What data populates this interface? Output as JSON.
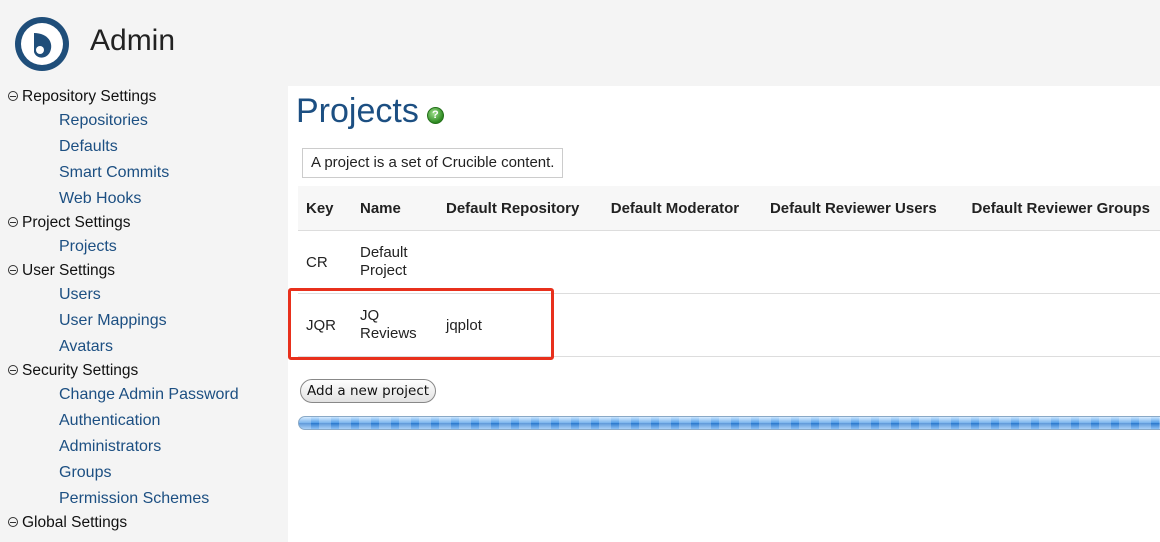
{
  "header": {
    "title": "Admin",
    "logo_icon": "crucible-logo-icon"
  },
  "sidebar": {
    "sections": [
      {
        "label": "Repository Settings",
        "items": [
          "Repositories",
          "Defaults",
          "Smart Commits",
          "Web Hooks"
        ]
      },
      {
        "label": "Project Settings",
        "items": [
          "Projects"
        ]
      },
      {
        "label": "User Settings",
        "items": [
          "Users",
          "User Mappings",
          "Avatars"
        ]
      },
      {
        "label": "Security Settings",
        "items": [
          "Change Admin Password",
          "Authentication",
          "Administrators",
          "Groups",
          "Permission Schemes"
        ]
      },
      {
        "label": "Global Settings",
        "items": []
      }
    ]
  },
  "main": {
    "title": "Projects",
    "help_icon": "help-icon",
    "description": "A project is a set of Crucible content.",
    "table": {
      "headers": [
        "Key",
        "Name",
        "Default Repository",
        "Default Moderator",
        "Default Reviewer Users",
        "Default Reviewer Groups"
      ],
      "rows": [
        [
          "CR",
          "Default Project",
          "",
          "",
          "",
          ""
        ],
        [
          "JQR",
          "JQ Reviews",
          "jqplot",
          "",
          "",
          ""
        ]
      ]
    },
    "add_button": "Add a new project",
    "progress_percent": 100
  },
  "colors": {
    "link": "#1c4f82",
    "highlight": "#e8301c",
    "progress": "#4f9be6"
  }
}
